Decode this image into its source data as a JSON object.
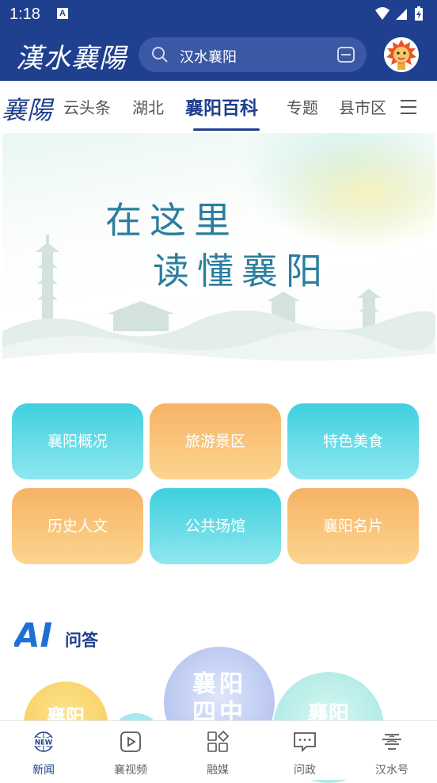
{
  "status_bar": {
    "time": "1:18",
    "notification_glyph": "A"
  },
  "header": {
    "logo": "漢水襄陽",
    "search": {
      "value": "汉水襄阳"
    },
    "icons": [
      "search-icon",
      "scan-icon",
      "avatar"
    ]
  },
  "channel_tabs": {
    "logo": "襄陽",
    "items": [
      {
        "label": "云头条"
      },
      {
        "label": "湖北"
      },
      {
        "label": "襄阳百科",
        "active": true
      },
      {
        "label": "专题"
      },
      {
        "label": "县市区"
      }
    ]
  },
  "banner": {
    "line1": "在这里",
    "line2": "读懂襄阳"
  },
  "categories": [
    {
      "label": "襄阳概况",
      "color": "blue"
    },
    {
      "label": "旅游景区",
      "color": "orange"
    },
    {
      "label": "特色美食",
      "color": "blue"
    },
    {
      "label": "历史人文",
      "color": "orange"
    },
    {
      "label": "公共场馆",
      "color": "blue"
    },
    {
      "label": "襄阳名片",
      "color": "orange"
    }
  ],
  "ai_section": {
    "logo": "AI",
    "label": "问答",
    "bubbles": [
      "襄阳",
      "襄阳四中",
      "襄阳"
    ]
  },
  "bottom_nav": [
    {
      "label": "新闻",
      "icon": "news-icon",
      "badge": "NEW",
      "active": true
    },
    {
      "label": "襄视频",
      "icon": "video-icon"
    },
    {
      "label": "融媒",
      "icon": "media-grid-icon"
    },
    {
      "label": "问政",
      "icon": "message-icon"
    },
    {
      "label": "汉水号",
      "icon": "hanshui-icon"
    }
  ],
  "colors": {
    "primary": "#1f3f8f",
    "cyan": "#3fd0de",
    "orange": "#f6b366",
    "banner_text": "#2c7e9e"
  }
}
